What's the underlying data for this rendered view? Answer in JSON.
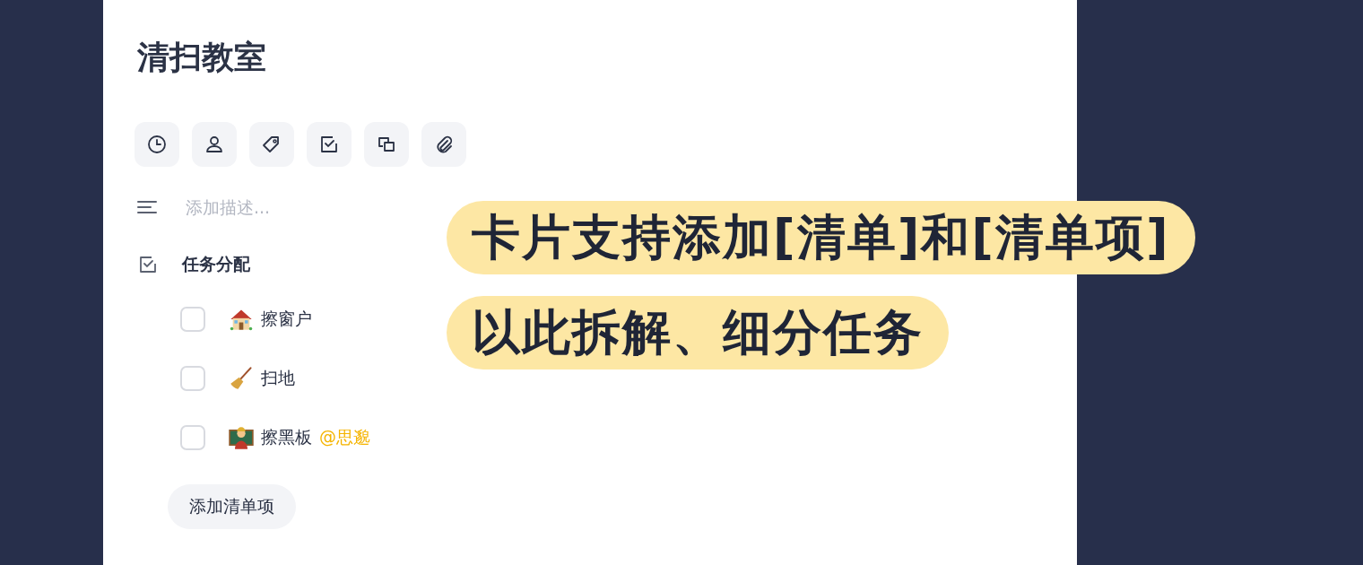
{
  "card": {
    "title": "清扫教室",
    "description": {
      "placeholder": "添加描述..."
    },
    "checklist": {
      "title": "任务分配",
      "items": [
        {
          "text": "擦窗户",
          "checked": false
        },
        {
          "text": "扫地",
          "checked": false
        },
        {
          "text": "擦黑板",
          "checked": false,
          "mention": "@思邈"
        }
      ],
      "add_button": "添加清单项"
    }
  },
  "callouts": [
    "卡片支持添加[清单]和[清单项]",
    "以此拆解、细分任务"
  ]
}
